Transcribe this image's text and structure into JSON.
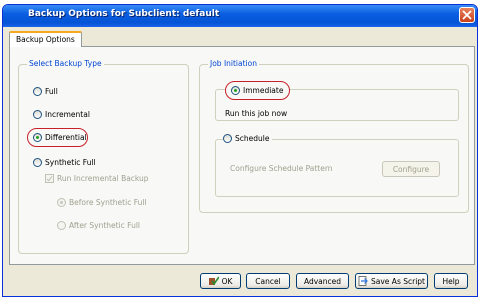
{
  "window": {
    "title": "Backup Options for Subclient: default"
  },
  "tab": {
    "label": "Backup Options"
  },
  "backup_type": {
    "label": "Select Backup Type",
    "options": {
      "full": "Full",
      "incremental": "Incremental",
      "differential": "Differential",
      "synthetic_full": "Synthetic Full"
    },
    "selected": "Differential",
    "run_incremental": "Run Incremental Backup",
    "before_synthetic": "Before Synthetic Full",
    "after_synthetic": "After Synthetic Full"
  },
  "job_initiation": {
    "label": "Job Initiation",
    "immediate": "Immediate",
    "immediate_desc": "Run this job now",
    "schedule": "Schedule",
    "schedule_desc": "Configure Schedule Pattern",
    "configure_label": "Configure"
  },
  "buttons": {
    "ok": "OK",
    "cancel": "Cancel",
    "advanced": "Advanced",
    "save_as_script": "Save As Script",
    "help": "Help"
  },
  "colors": {
    "titlebar": "#0a5fe0",
    "highlight": "#c8202a",
    "group_label": "#0046d5"
  }
}
